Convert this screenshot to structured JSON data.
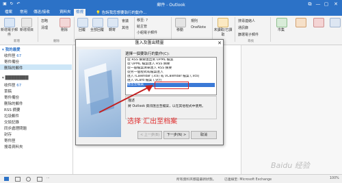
{
  "titlebar": {
    "title": "郵件 - Outlook",
    "min": "—",
    "max": "▢",
    "close": "✕",
    "restore": "⧉"
  },
  "tabs": {
    "file": "檔案",
    "home": "常用",
    "send_receive": "傳送/接收",
    "folder": "資料夾",
    "view": "檢視",
    "tell": "告訴我您想要執行的動作..."
  },
  "ribbon": {
    "new_email": "新增電子郵件",
    "new_items": "新增項目",
    "ignore": "忽略",
    "cleanup": "清理",
    "delete": "刪除",
    "reply": "回覆",
    "reply_all": "全部回覆",
    "forward": "轉寄",
    "meeting": "會議",
    "more": "其他",
    "quick_1": "移至: ?",
    "quick_2": "給主管",
    "quick_3": "小組電子郵件",
    "move": "移動",
    "rules": "規則",
    "onenote": "OneNote",
    "unread": "未讀取/已讀取",
    "search_people": "搜尋連絡人",
    "address_book": "通訊錄",
    "filter_email": "篩選電子郵件",
    "store": "市集",
    "grp_new": "新增",
    "grp_delete": "刪除",
    "grp_respond": "回應",
    "grp_quick": "快速步驟",
    "grp_find": "尋找"
  },
  "nav": {
    "favorites": "▾ 我的最愛",
    "fav_items": [
      "收件匣",
      "寄件備份",
      "刪除的郵件"
    ],
    "inbox_count": "67",
    "account": "▾ ████████",
    "acc_items": [
      "收件匣",
      "草稿",
      "寄件備份",
      "刪除的郵件",
      "RSS 摘要",
      "垃圾郵件",
      "交談記錄",
      "同步處理問題",
      "封存",
      "寄件匣",
      "搜尋資料夾"
    ],
    "acc_inbox_count": "67"
  },
  "dialog": {
    "title": "匯入及匯出精靈",
    "close": "✕",
    "prompt": "選擇一個要執行的動作(C):",
    "actions": [
      "從 RSS 摘要匯出到 OPML 檔案",
      "從 OPML 檔案匯入 RSS 摘要",
      "從一般檔案清單匯入 RSS 摘要",
      "從另一個程式或檔案匯入",
      "匯入 iCalendar (.ics) 或 vCalendar 檔案 (.vcs)",
      "匯入 vCard 檔案 (.vcf)",
      "匯出至檔案"
    ],
    "selected_index": 6,
    "desc_label": "描述",
    "desc_text": "將 Outlook 資訊匯出至檔案，以在其他程式中使用。",
    "btn_back": "< 上一步(B)",
    "btn_next": "下一步(N) >",
    "btn_cancel": "取消"
  },
  "annotation": "选择 汇出至档案",
  "status": {
    "folders": "所有資料夾都是最新狀態。",
    "connected": "已連線至: Microsoft Exchange",
    "zoom": "100%"
  },
  "watermark": "Baidu 经验",
  "colors": {
    "accent": "#2c72c7",
    "annotation_red": "#e02020",
    "selection": "#3a79d6"
  }
}
